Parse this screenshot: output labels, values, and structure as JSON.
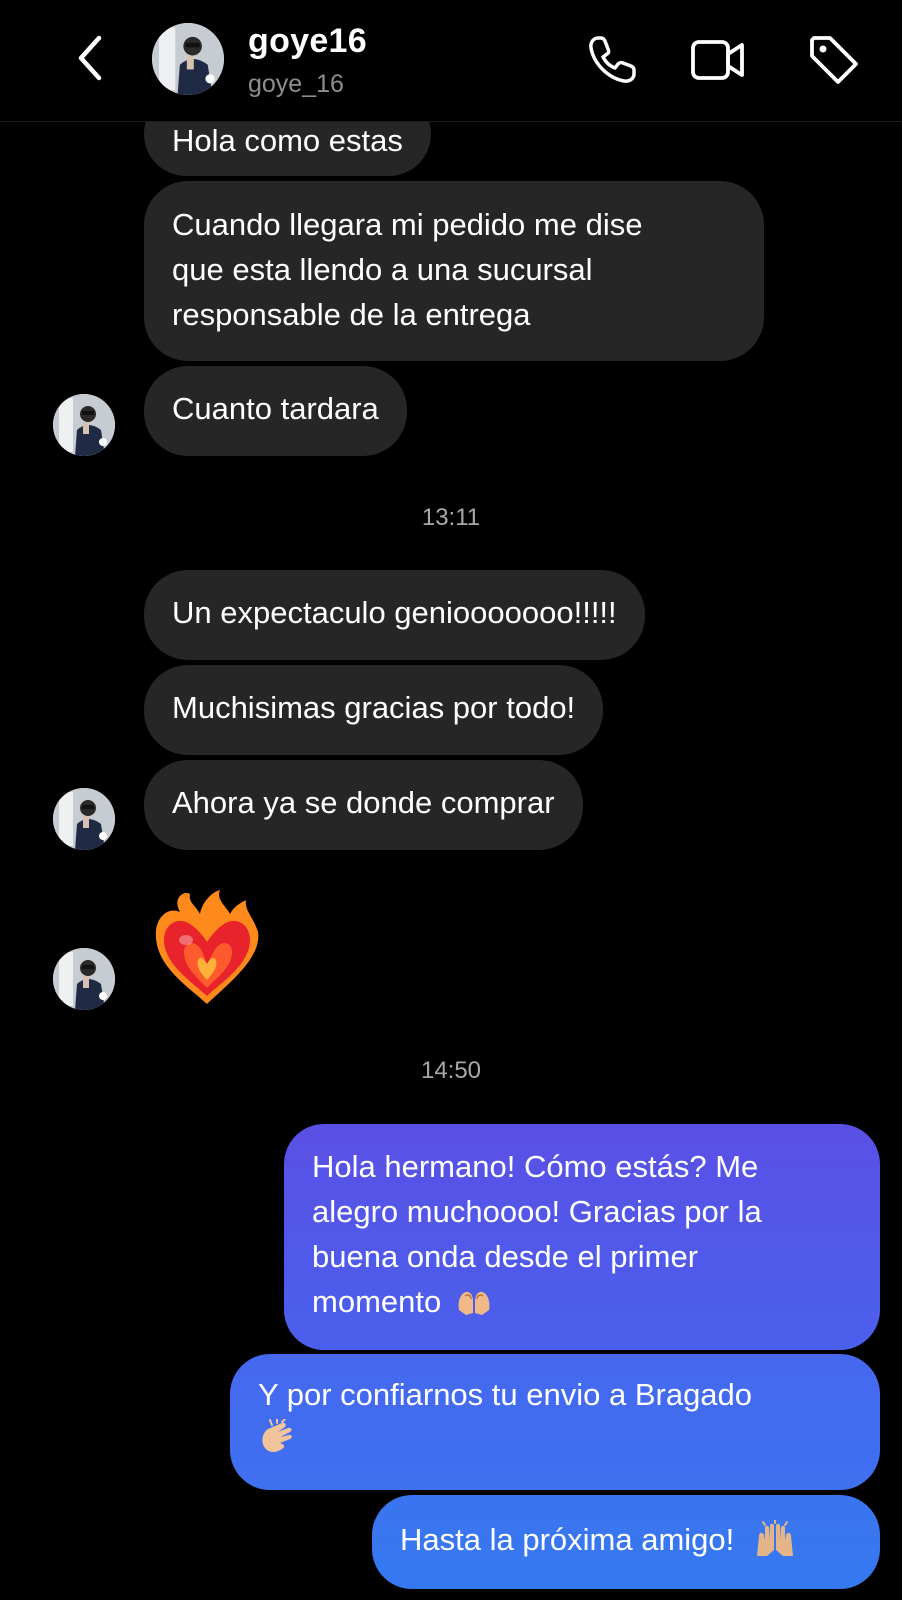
{
  "header": {
    "name": "goye16",
    "handle": "goye_16",
    "icons": [
      "back-icon",
      "phone-icon",
      "video-camera-icon",
      "tag-icon"
    ]
  },
  "timestamps": [
    "13:11",
    "14:50"
  ],
  "messages_in": [
    "Hola como estas",
    [
      "Cuando llegara mi pedido me dise",
      "que esta llendo a una sucursal",
      "responsable de la entrega"
    ],
    "Cuanto tardara",
    "Un expectaculo geniooooooo!!!!!",
    "Muchisimas gracias por todo!",
    "Ahora ya se donde comprar"
  ],
  "reaction_emoji": "heart-on-fire-emoji",
  "messages_out": [
    [
      "Hola hermano! Cómo estás? Me",
      "alegro muchoooo! Gracias por la",
      "buena onda desde el primer",
      "momento"
    ],
    [
      "Y por confiarnos tu envio a Bragado"
    ],
    [
      "Hasta la próxima amigo!"
    ]
  ],
  "colors": {
    "background": "#000000",
    "incoming_bubble": "#262626",
    "outgoing_gradient_top": "#5b4fe8",
    "outgoing_gradient_bottom": "#3478f0",
    "timestamp": "#a8a8a8",
    "handle": "#8e8e8e"
  }
}
